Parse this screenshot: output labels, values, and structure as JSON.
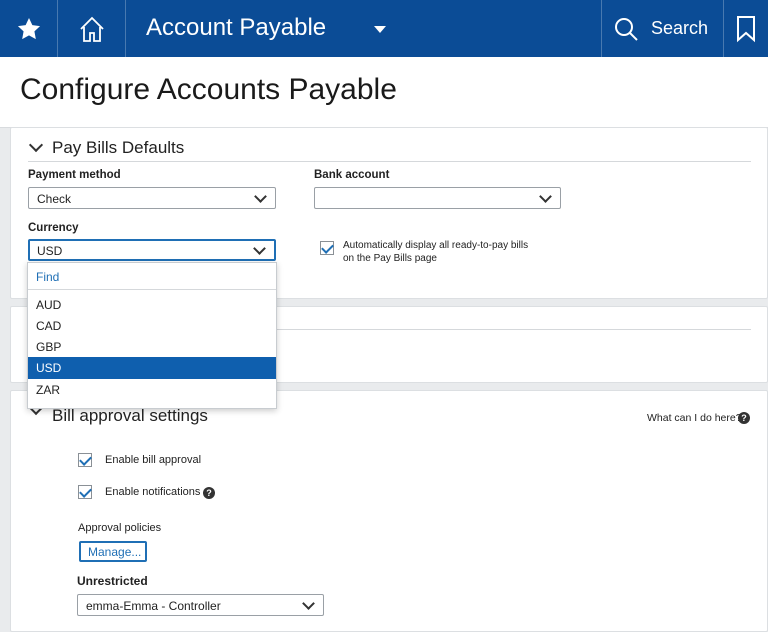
{
  "topbar": {
    "title": "Account Payable",
    "search_label": "Search"
  },
  "page": {
    "title": "Configure Accounts Payable"
  },
  "pay_bills": {
    "title": "Pay Bills Defaults",
    "payment_method_label": "Payment method",
    "payment_method_value": "Check",
    "bank_account_label": "Bank account",
    "bank_account_value": "",
    "currency_label": "Currency",
    "currency_value": "USD",
    "auto_display_line1": "Automatically display all ready-to-pay bills",
    "auto_display_line2": "on the Pay Bills page",
    "auto_display_checked": true
  },
  "currency_dropdown": {
    "find_label": "Find",
    "options": [
      "AUD",
      "CAD",
      "GBP",
      "USD",
      "ZAR"
    ],
    "selected": "USD"
  },
  "bill_approval": {
    "title": "Bill approval settings",
    "help_link": "What can I do here?",
    "enable_approval_label": "Enable bill approval",
    "enable_notifications_label": "Enable notifications",
    "approval_policies_label": "Approval policies",
    "manage_button": "Manage...",
    "unrestricted_label": "Unrestricted",
    "unrestricted_value": "emma-Emma - Controller"
  },
  "colors": {
    "topbar": "#0b4c96",
    "accent": "#1f6fb5",
    "selected": "#0f5fae"
  },
  "icons": [
    "star-icon",
    "home-icon",
    "caret-down-icon",
    "search-icon",
    "bookmark-icon",
    "chevron-down-icon",
    "check-icon",
    "help-icon"
  ]
}
